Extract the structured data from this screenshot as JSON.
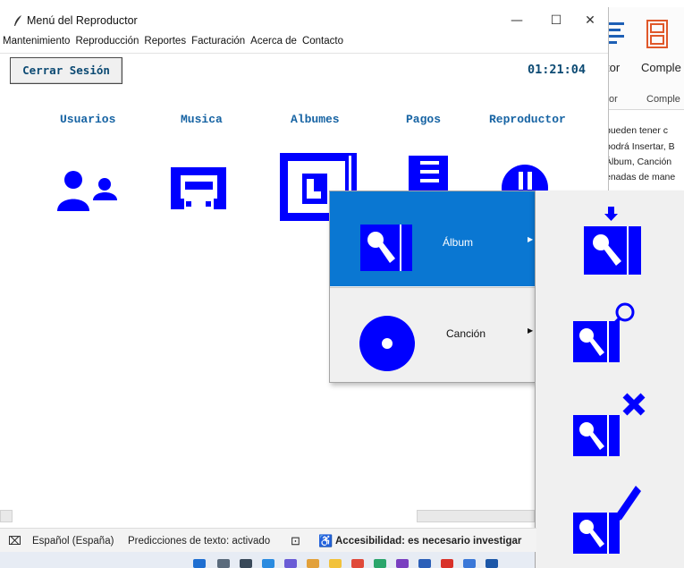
{
  "window": {
    "title": "Menú del Reproductor",
    "controls": {
      "minimize": "—",
      "maximize": "☐",
      "close": "✕"
    }
  },
  "menubar": [
    "Mantenimiento",
    "Reproducción",
    "Reportes",
    "Facturación",
    "Acerca de",
    "Contacto"
  ],
  "header": {
    "logout_label": "Cerrar Sesión",
    "clock": "01:21:04"
  },
  "sections": [
    "Usuarios",
    "Musica",
    "Albumes",
    "Pagos",
    "Reproductor"
  ],
  "context_menu": {
    "items": [
      {
        "label": "Álbum",
        "icon": "album-mic-icon",
        "highlighted": true
      },
      {
        "label": "Canción",
        "icon": "disc-icon",
        "highlighted": false
      }
    ],
    "submenu_icons": [
      "album-insert-icon",
      "album-search-icon",
      "album-delete-icon",
      "album-edit-icon"
    ]
  },
  "background": {
    "ribbon": {
      "label1": "tor",
      "label2": "Comple",
      "sub1": "tor",
      "sub2": "Comple"
    },
    "doc_lines": [
      "pueden tener c",
      "podrá Insertar, B",
      "Álbum, Canción",
      "enadas de mane"
    ]
  },
  "statusbar": {
    "language": "Español (España)",
    "predictions": "Predicciones de texto: activado",
    "accessibility": "Accesibilidad: es necesario investigar"
  },
  "colors": {
    "icon_blue": "#0000ff",
    "highlight": "#0a77d2",
    "label_blue": "#1663a3",
    "clock_blue": "#0c4a73"
  }
}
